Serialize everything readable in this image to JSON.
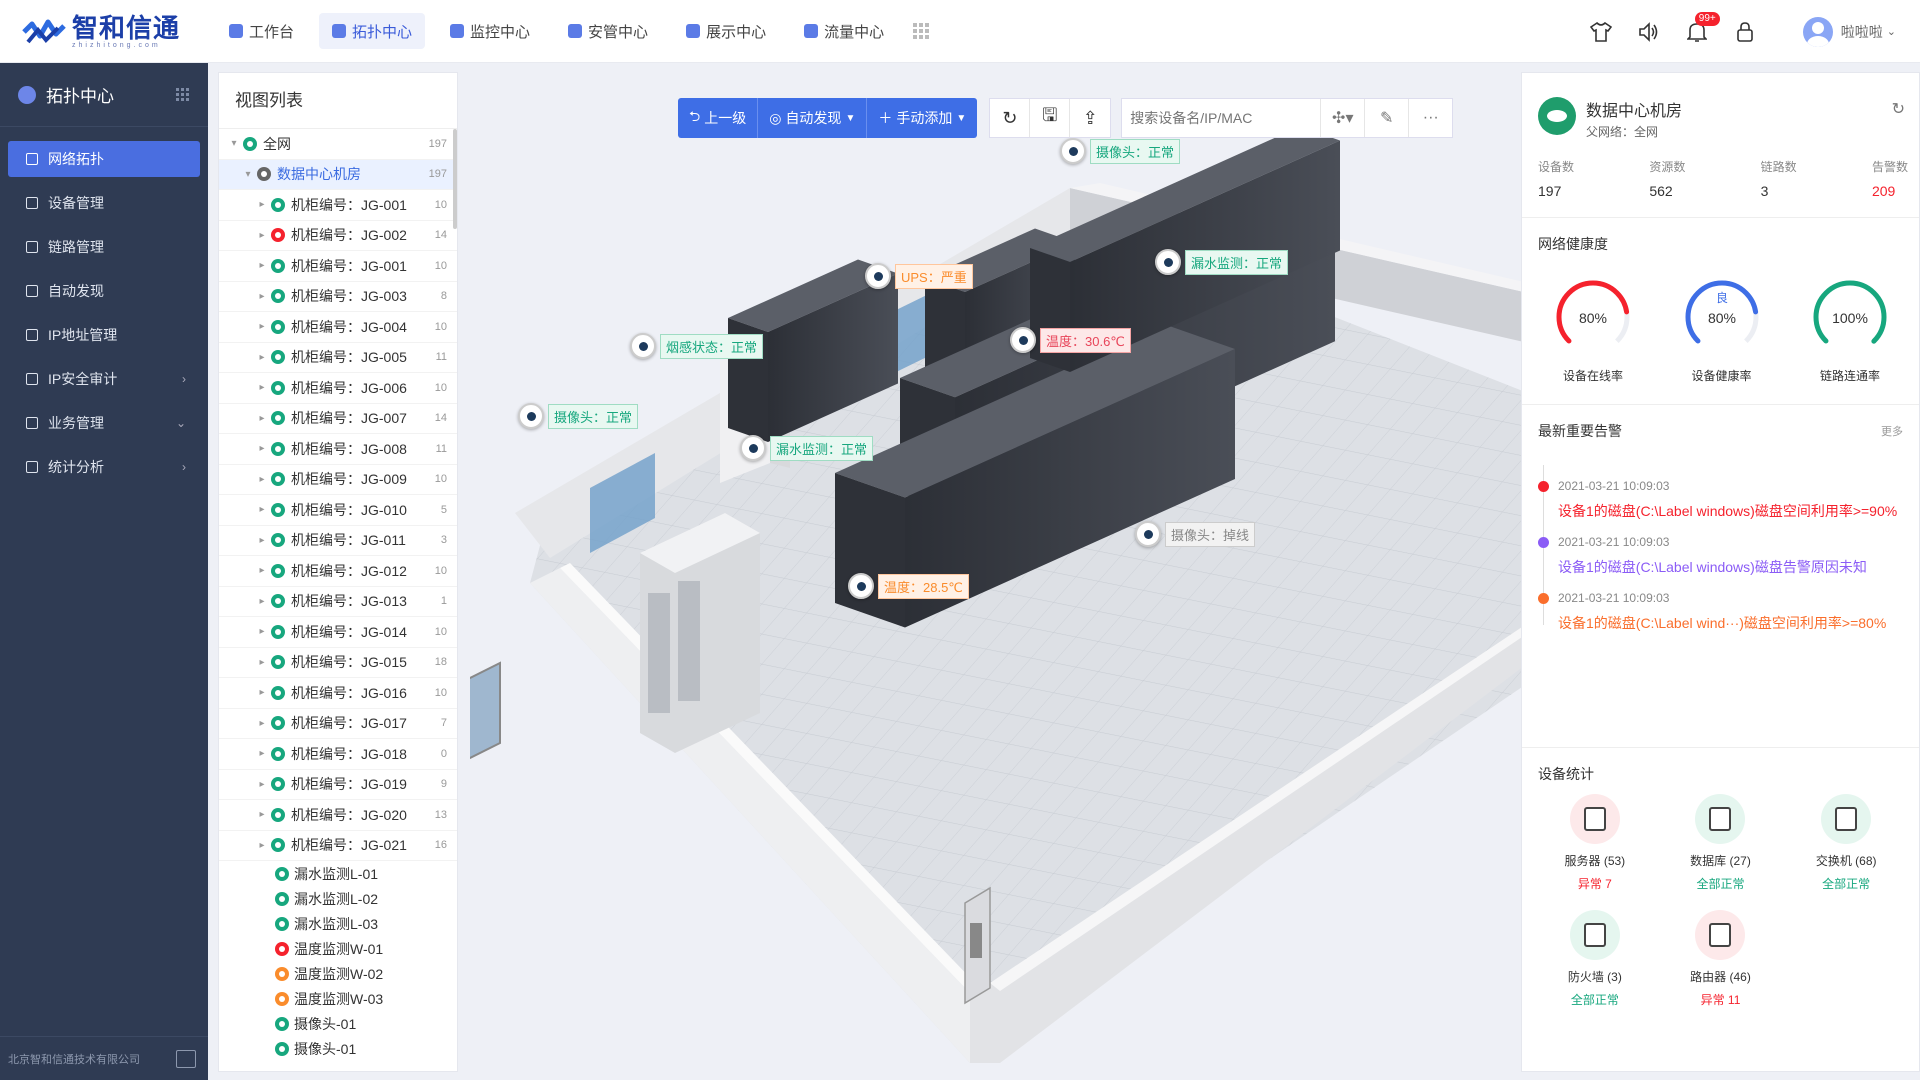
{
  "brand": {
    "name_cn": "智和信通",
    "name_en": "zhizhitong.com"
  },
  "nav": [
    {
      "label": "工作台"
    },
    {
      "label": "拓扑中心",
      "active": true
    },
    {
      "label": "监控中心"
    },
    {
      "label": "安管中心"
    },
    {
      "label": "展示中心"
    },
    {
      "label": "流量中心"
    }
  ],
  "header": {
    "notification_count": "99+",
    "user_name": "啦啦啦"
  },
  "sidebar": {
    "title": "拓扑中心",
    "items": [
      {
        "label": "网络拓扑",
        "active": true
      },
      {
        "label": "设备管理"
      },
      {
        "label": "链路管理"
      },
      {
        "label": "自动发现"
      },
      {
        "label": "IP地址管理"
      },
      {
        "label": "IP安全审计",
        "arrow": "›"
      },
      {
        "label": "业务管理",
        "arrow": "⌄"
      },
      {
        "label": "统计分析",
        "arrow": "›"
      }
    ],
    "footer": "北京智和信通技术有限公司"
  },
  "viewlist": {
    "title": "视图列表",
    "root": {
      "label": "全网",
      "count": "197"
    },
    "selected": {
      "label": "数据中心机房",
      "count": "197"
    },
    "cabinets": [
      {
        "label": "机柜编号：JG-001",
        "count": "10",
        "status": "ok"
      },
      {
        "label": "机柜编号：JG-002",
        "count": "14",
        "status": "err"
      },
      {
        "label": "机柜编号：JG-001",
        "count": "10",
        "status": "ok"
      },
      {
        "label": "机柜编号：JG-003",
        "count": "8",
        "status": "ok"
      },
      {
        "label": "机柜编号：JG-004",
        "count": "10",
        "status": "ok"
      },
      {
        "label": "机柜编号：JG-005",
        "count": "11",
        "status": "ok"
      },
      {
        "label": "机柜编号：JG-006",
        "count": "10",
        "status": "ok"
      },
      {
        "label": "机柜编号：JG-007",
        "count": "14",
        "status": "ok"
      },
      {
        "label": "机柜编号：JG-008",
        "count": "11",
        "status": "ok"
      },
      {
        "label": "机柜编号：JG-009",
        "count": "10",
        "status": "ok"
      },
      {
        "label": "机柜编号：JG-010",
        "count": "5",
        "status": "ok"
      },
      {
        "label": "机柜编号：JG-011",
        "count": "3",
        "status": "ok"
      },
      {
        "label": "机柜编号：JG-012",
        "count": "10",
        "status": "ok"
      },
      {
        "label": "机柜编号：JG-013",
        "count": "1",
        "status": "ok"
      },
      {
        "label": "机柜编号：JG-014",
        "count": "10",
        "status": "ok"
      },
      {
        "label": "机柜编号：JG-015",
        "count": "18",
        "status": "ok"
      },
      {
        "label": "机柜编号：JG-016",
        "count": "10",
        "status": "ok"
      },
      {
        "label": "机柜编号：JG-017",
        "count": "7",
        "status": "ok"
      },
      {
        "label": "机柜编号：JG-018",
        "count": "0",
        "status": "ok"
      },
      {
        "label": "机柜编号：JG-019",
        "count": "9",
        "status": "ok"
      },
      {
        "label": "机柜编号：JG-020",
        "count": "13",
        "status": "ok"
      },
      {
        "label": "机柜编号：JG-021",
        "count": "16",
        "status": "ok"
      }
    ],
    "sensors": [
      {
        "label": "漏水监测L-01",
        "status": "ok"
      },
      {
        "label": "漏水监测L-02",
        "status": "ok"
      },
      {
        "label": "漏水监测L-03",
        "status": "ok"
      },
      {
        "label": "温度监测W-01",
        "status": "err"
      },
      {
        "label": "温度监测W-02",
        "status": "warn"
      },
      {
        "label": "温度监测W-03",
        "status": "warn"
      },
      {
        "label": "摄像头-01",
        "status": "ok"
      },
      {
        "label": "摄像头-01",
        "status": "ok"
      }
    ]
  },
  "toolbar": {
    "back": "上一级",
    "discover": "自动发现",
    "add": "手动添加",
    "search_placeholder": "搜索设备名/IP/MAC"
  },
  "scene_labels": [
    {
      "text": "摄像头：正常",
      "kind": "ok"
    },
    {
      "text": "UPS：严重",
      "kind": "warn"
    },
    {
      "text": "漏水监测：正常",
      "kind": "ok"
    },
    {
      "text": "烟感状态：正常",
      "kind": "ok"
    },
    {
      "text": "温度：30.6℃",
      "kind": "err"
    },
    {
      "text": "摄像头：正常",
      "kind": "ok"
    },
    {
      "text": "漏水监测：正常",
      "kind": "ok"
    },
    {
      "text": "摄像头：掉线",
      "kind": "off"
    },
    {
      "text": "温度：28.5℃",
      "kind": "warn"
    }
  ],
  "panel": {
    "name": "数据中心机房",
    "parent": "父网络：全网",
    "stats": [
      {
        "k": "设备数",
        "v": "197"
      },
      {
        "k": "资源数",
        "v": "562"
      },
      {
        "k": "链路数",
        "v": "3"
      },
      {
        "k": "告警数",
        "v": "209",
        "red": true
      }
    ],
    "health_title": "网络健康度",
    "gauges": [
      {
        "value": "80%",
        "label": "设备在线率",
        "pct": 0.8,
        "color": "#f5222d",
        "top": ""
      },
      {
        "value": "80%",
        "label": "设备健康率",
        "pct": 0.8,
        "color": "#3e6ee6",
        "top": "良"
      },
      {
        "value": "100%",
        "label": "链路连通率",
        "pct": 1.0,
        "color": "#17a77e",
        "top": ""
      }
    ],
    "alerts_title": "最新重要告警",
    "alerts_more": "更多",
    "alerts": [
      {
        "time": "2021-03-21 10:09:03",
        "msg": "设备1的磁盘(C:\\Label windows)磁盘空间利用率>=90%",
        "color": "#f5222d"
      },
      {
        "time": "2021-03-21 10:09:03",
        "msg": "设备1的磁盘(C:\\Label windows)磁盘告警原因未知",
        "color": "#8b5cf6"
      },
      {
        "time": "2021-03-21 10:09:03",
        "msg": "设备1的磁盘(C:\\Label wind···)磁盘空间利用率>=80%",
        "color": "#fa6e2c"
      }
    ],
    "devices_title": "设备统计",
    "devices": [
      {
        "name": "服务器 (53)",
        "status": "异常 7",
        "bad": true
      },
      {
        "name": "数据库 (27)",
        "status": "全部正常",
        "bad": false
      },
      {
        "name": "交换机 (68)",
        "status": "全部正常",
        "bad": false
      },
      {
        "name": "防火墙 (3)",
        "status": "全部正常",
        "bad": false
      },
      {
        "name": "路由器 (46)",
        "status": "异常 11",
        "bad": true
      }
    ]
  }
}
